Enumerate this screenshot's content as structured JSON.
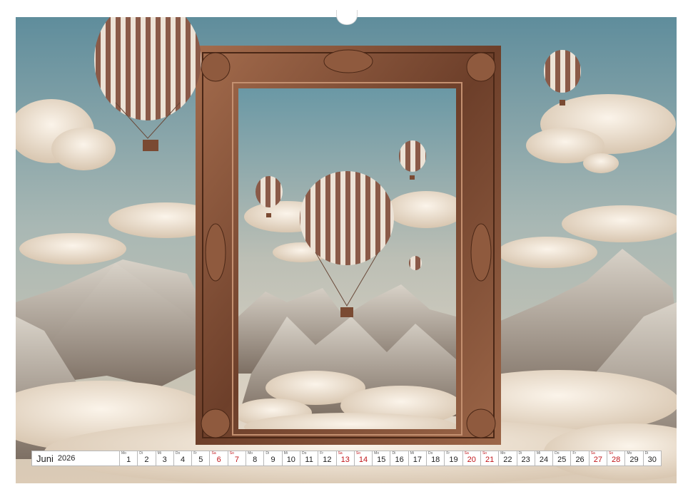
{
  "calendar": {
    "month": "Juni",
    "year": "2026",
    "days": [
      {
        "wd": "Mo",
        "n": "1",
        "weekend": false
      },
      {
        "wd": "Di",
        "n": "2",
        "weekend": false
      },
      {
        "wd": "Mi",
        "n": "3",
        "weekend": false
      },
      {
        "wd": "Do",
        "n": "4",
        "weekend": false
      },
      {
        "wd": "Fr",
        "n": "5",
        "weekend": false
      },
      {
        "wd": "Sa",
        "n": "6",
        "weekend": true
      },
      {
        "wd": "So",
        "n": "7",
        "weekend": true
      },
      {
        "wd": "Mo",
        "n": "8",
        "weekend": false
      },
      {
        "wd": "Di",
        "n": "9",
        "weekend": false
      },
      {
        "wd": "Mi",
        "n": "10",
        "weekend": false
      },
      {
        "wd": "Do",
        "n": "11",
        "weekend": false
      },
      {
        "wd": "Fr",
        "n": "12",
        "weekend": false
      },
      {
        "wd": "Sa",
        "n": "13",
        "weekend": true
      },
      {
        "wd": "So",
        "n": "14",
        "weekend": true
      },
      {
        "wd": "Mo",
        "n": "15",
        "weekend": false
      },
      {
        "wd": "Di",
        "n": "16",
        "weekend": false
      },
      {
        "wd": "Mi",
        "n": "17",
        "weekend": false
      },
      {
        "wd": "Do",
        "n": "18",
        "weekend": false
      },
      {
        "wd": "Fr",
        "n": "19",
        "weekend": false
      },
      {
        "wd": "Sa",
        "n": "20",
        "weekend": true
      },
      {
        "wd": "So",
        "n": "21",
        "weekend": true
      },
      {
        "wd": "Mo",
        "n": "22",
        "weekend": false
      },
      {
        "wd": "Di",
        "n": "23",
        "weekend": false
      },
      {
        "wd": "Mi",
        "n": "24",
        "weekend": false
      },
      {
        "wd": "Do",
        "n": "25",
        "weekend": false
      },
      {
        "wd": "Fr",
        "n": "26",
        "weekend": false
      },
      {
        "wd": "Sa",
        "n": "27",
        "weekend": true
      },
      {
        "wd": "So",
        "n": "28",
        "weekend": true
      },
      {
        "wd": "Mo",
        "n": "29",
        "weekend": false
      },
      {
        "wd": "Di",
        "n": "30",
        "weekend": false
      }
    ]
  },
  "colors": {
    "sky_top": "#6f9aa8",
    "sky_bottom": "#d9cbb8",
    "frame": "#7a4a32",
    "frame_light": "#b07a58",
    "balloon_stripe_a": "#8a5a48",
    "balloon_stripe_b": "#ece2d6",
    "weekend": "#c0161a"
  },
  "icons": [
    "ring-binding-icon",
    "hot-air-balloon-icon",
    "ornate-frame-icon"
  ]
}
